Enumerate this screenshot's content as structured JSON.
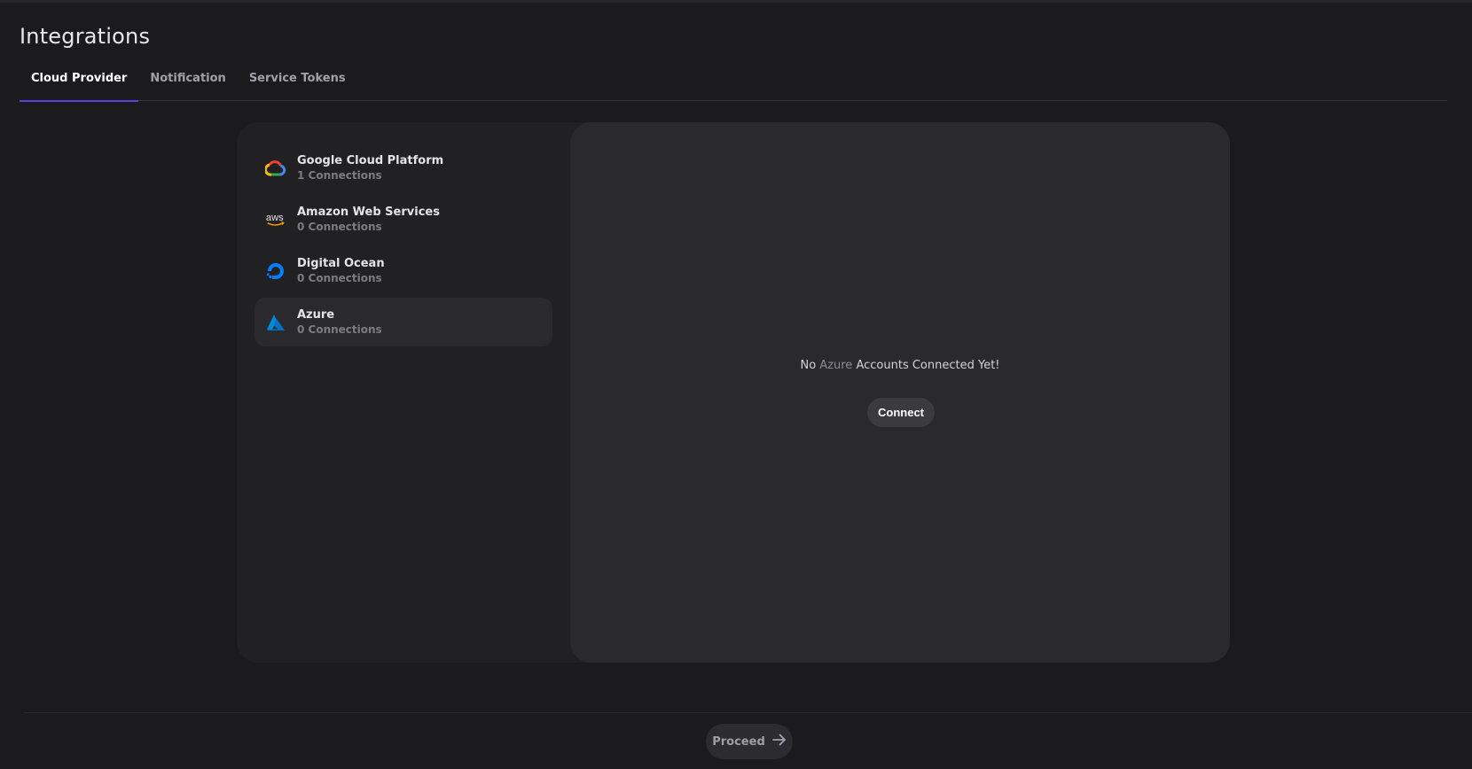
{
  "page": {
    "title": "Integrations"
  },
  "tabs": [
    {
      "label": "Cloud Provider",
      "active": true
    },
    {
      "label": "Notification",
      "active": false
    },
    {
      "label": "Service Tokens",
      "active": false
    }
  ],
  "providers": [
    {
      "name": "Google Cloud Platform",
      "connections": "1 Connections",
      "icon": "google-cloud-icon"
    },
    {
      "name": "Amazon Web Services",
      "connections": "0 Connections",
      "icon": "aws-icon"
    },
    {
      "name": "Digital Ocean",
      "connections": "0 Connections",
      "icon": "digital-ocean-icon"
    },
    {
      "name": "Azure",
      "connections": "0 Connections",
      "icon": "azure-icon",
      "selected": true
    }
  ],
  "detail": {
    "empty_prefix": "No",
    "empty_provider": "Azure",
    "empty_suffix": "Accounts Connected Yet!",
    "connect_label": "Connect"
  },
  "footer": {
    "proceed_label": "Proceed",
    "proceed_icon": "arrow-right-icon"
  },
  "colors": {
    "accent": "#5b3fe0",
    "background": "#1b1b1d"
  }
}
